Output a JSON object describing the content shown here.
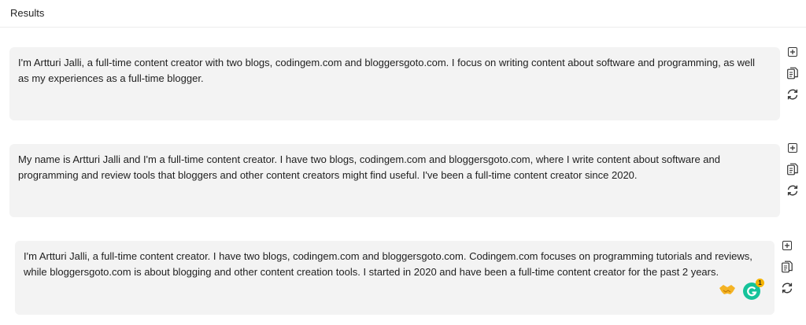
{
  "header": {
    "title": "Results"
  },
  "results": [
    {
      "text": "I'm Artturi Jalli, a full-time content creator with two blogs, codingem.com and bloggersgoto.com. I focus on writing content about software and programming, as well as my experiences as a full-time blogger."
    },
    {
      "text": "My name is Artturi Jalli and I'm a full-time content creator. I have two blogs, codingem.com and bloggersgoto.com, where I write content about software and programming and review tools that bloggers and other content creators might find useful. I've been a full-time content creator since 2020."
    },
    {
      "text": "I'm Artturi Jalli, a full-time content creator. I have two blogs, codingem.com and bloggersgoto.com. Codingem.com focuses on programming tutorials and reviews, while bloggersgoto.com is about blogging and other content creation tools. I started in 2020 and have been a full-time content creator for the past 2 years."
    }
  ],
  "actions": {
    "add_icon": "plus-square-icon",
    "copy_icon": "copy-icon",
    "regenerate_icon": "refresh-icon"
  },
  "grammarly": {
    "badge_count": "1",
    "color": "#15c39a"
  },
  "colors": {
    "card_bg": "#f3f3f3",
    "text": "#1e1e1e"
  }
}
